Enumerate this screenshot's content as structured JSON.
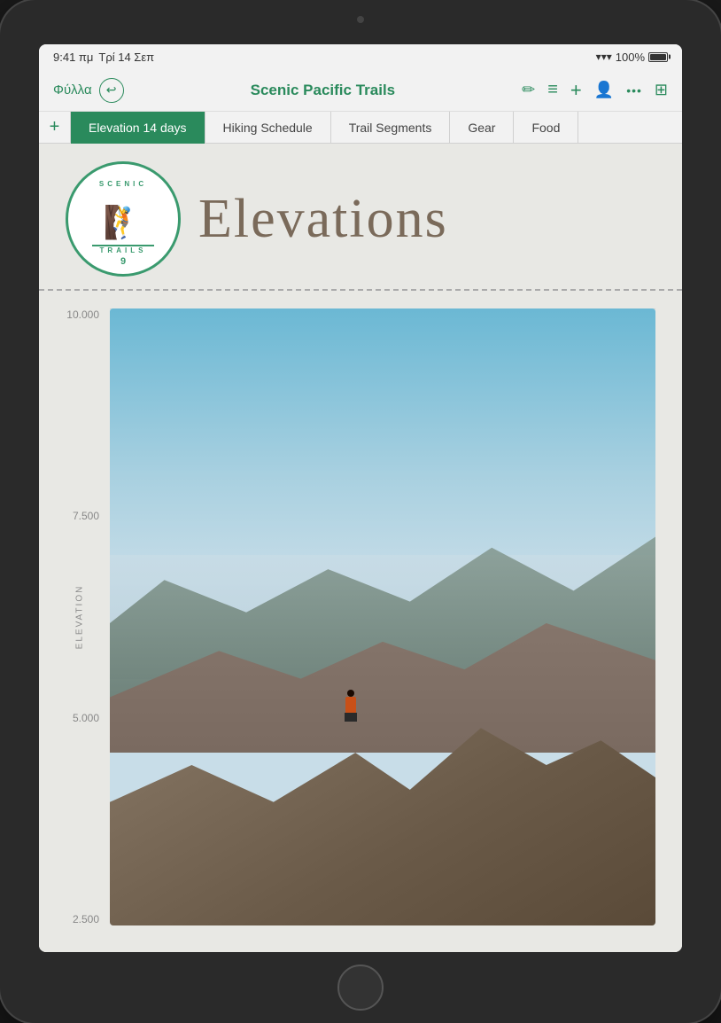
{
  "device": {
    "camera": "camera-dot",
    "home_button": "home-button"
  },
  "status_bar": {
    "time": "9:41 πμ",
    "day": "Τρί 14 Σεπ",
    "wifi": "WiFi",
    "battery_percent": "100%"
  },
  "toolbar": {
    "back_label": "Φύλλα",
    "title": "Scenic Pacific Trails",
    "undo_icon": "↩",
    "filter_icon": "≡",
    "add_icon": "+",
    "share_icon": "👤",
    "more_icon": "···",
    "table_icon": "⊞"
  },
  "tabs": {
    "add_label": "+",
    "items": [
      {
        "label": "Elevation 14 days",
        "active": true
      },
      {
        "label": "Hiking Schedule",
        "active": false
      },
      {
        "label": "Trail Segments",
        "active": false
      },
      {
        "label": "Gear",
        "active": false
      },
      {
        "label": "Food",
        "active": false
      }
    ]
  },
  "header": {
    "logo": {
      "top_text": "SCENIC",
      "bottom_text": "TRAILS",
      "number": "9",
      "hiker_icon": "🚶"
    },
    "title": "Elevations"
  },
  "chart": {
    "y_axis_label": "ELEVATION",
    "y_ticks": [
      "10.000",
      "7.500",
      "5.000",
      "2.500"
    ],
    "description": "Elevation chart with mountain photo background"
  }
}
